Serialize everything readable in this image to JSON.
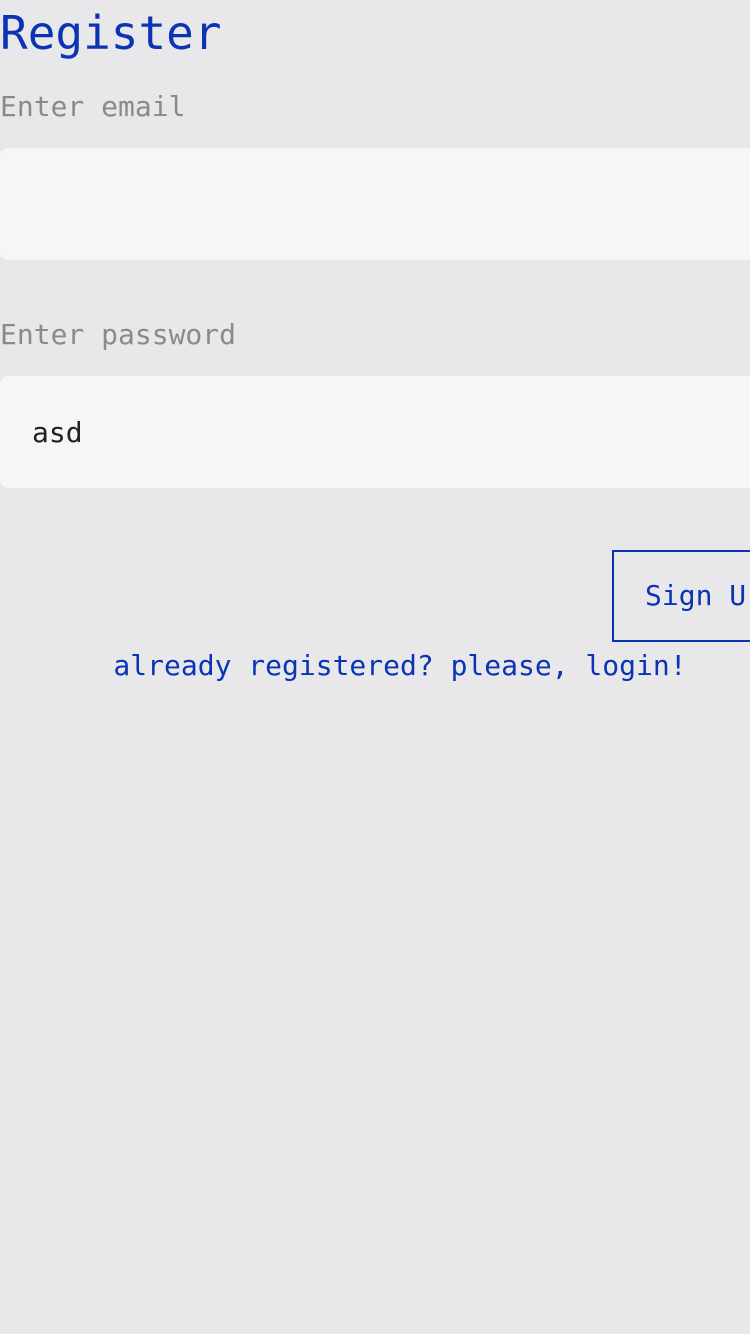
{
  "page": {
    "title": "Register"
  },
  "form": {
    "email": {
      "label": "Enter email",
      "value": "",
      "placeholder": ""
    },
    "password": {
      "label": "Enter password",
      "value": "asd",
      "placeholder": ""
    },
    "signup_label": "Sign U",
    "login_link_text": "already registered? please, login!"
  },
  "colors": {
    "background": "#e8e8ea",
    "accent": "#0b34b5",
    "field_background": "#f6f6f6",
    "label_text": "#8a8a8a"
  }
}
